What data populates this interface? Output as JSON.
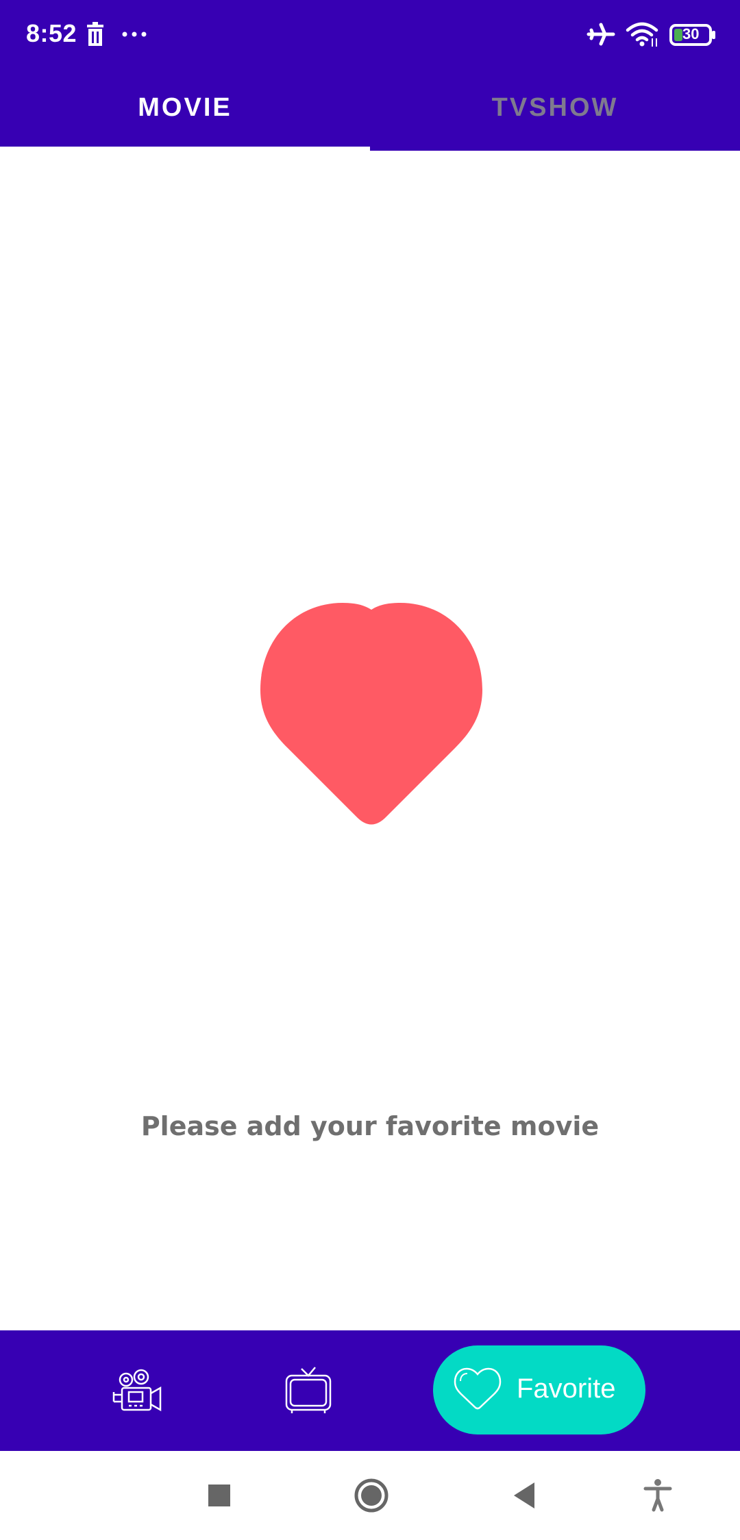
{
  "status_bar": {
    "time": "8:52",
    "battery": "30",
    "icons": [
      "trash-icon",
      "more-dots-icon",
      "airplane-icon",
      "wifi-icon",
      "battery-icon"
    ]
  },
  "tabs": [
    {
      "label": "MOVIE",
      "selected": true
    },
    {
      "label": "TVSHOW",
      "selected": false
    }
  ],
  "empty_state": {
    "icon": "heart-icon",
    "message": "Please add your favorite movie",
    "heart_color": "#ff5a64"
  },
  "bottom_nav": {
    "items": [
      {
        "icon": "movie-camera-icon"
      },
      {
        "icon": "tv-icon"
      },
      {
        "icon": "heart-outline-icon",
        "label": "Favorite",
        "selected": true
      }
    ]
  },
  "system_nav": {
    "icons": [
      "recents-square-icon",
      "home-circle-icon",
      "back-triangle-icon",
      "accessibility-icon"
    ]
  },
  "colors": {
    "primary": "#3700b3",
    "accent": "#03dac5",
    "tab_inactive": "#7f7a8f",
    "message_text": "#6f6f6f"
  }
}
